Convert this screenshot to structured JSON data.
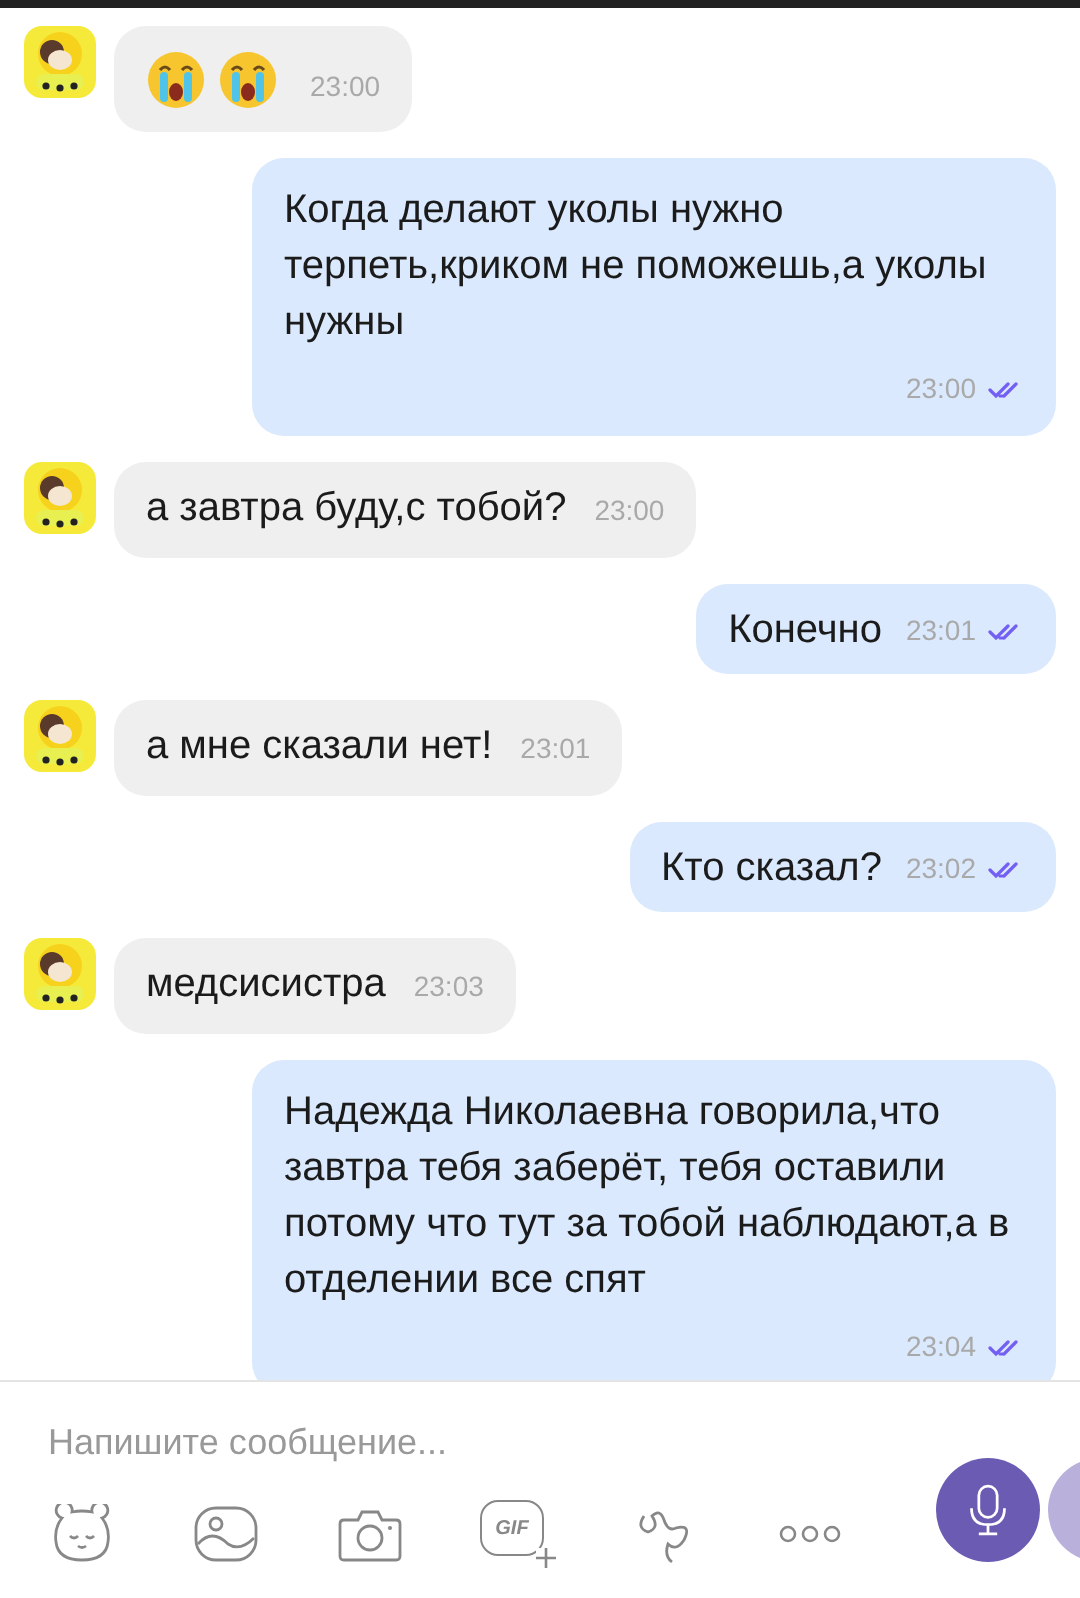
{
  "messages": [
    {
      "kind": "emoji",
      "emojis": [
        {
          "kind": "crying"
        },
        {
          "kind": "crying"
        }
      ],
      "time": "23:00"
    },
    {
      "kind": "outgoing",
      "text": "Когда делают уколы нужно терпеть,криком не поможешь,а уколы нужны",
      "time": "23:00",
      "read": true
    },
    {
      "kind": "incoming",
      "text": "а завтра буду,с тобой?",
      "time": "23:00"
    },
    {
      "kind": "outgoing",
      "text": "Конечно",
      "time": "23:01",
      "read": true
    },
    {
      "kind": "incoming",
      "text": "а мне сказали нет!",
      "time": "23:01"
    },
    {
      "kind": "outgoing",
      "text": "Кто сказал?",
      "time": "23:02",
      "read": true
    },
    {
      "kind": "incoming",
      "text": "медсисистра",
      "time": "23:03"
    },
    {
      "kind": "outgoing",
      "text": "Надежда Николаевна говорила,что завтра тебя заберёт, тебя оставили потому что тут за тобой наблюдают,а в отделении все спят",
      "time": "23:04",
      "read": true
    }
  ],
  "composer": {
    "placeholder": "Напишите сообщение...",
    "gif_label": "GIF"
  }
}
